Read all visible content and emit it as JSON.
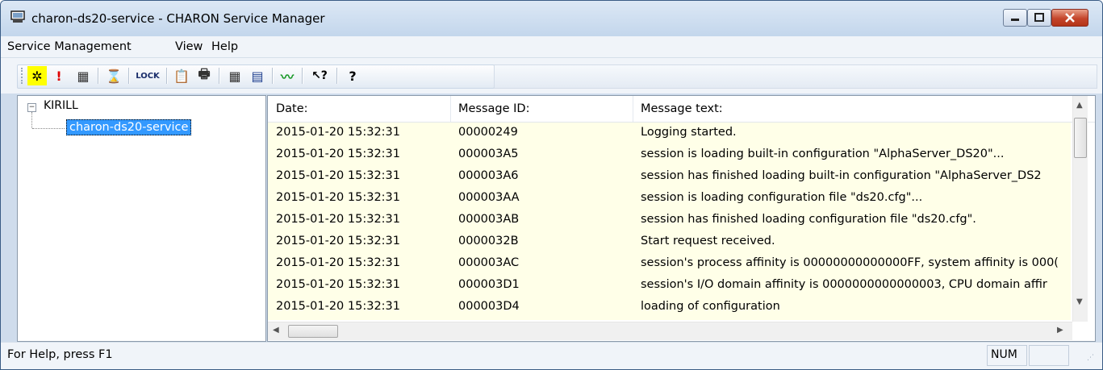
{
  "window": {
    "title": "charon-ds20-service - CHARON Service Manager",
    "controls": {
      "minimize": "minimize",
      "maximize": "maximize",
      "close": "close"
    }
  },
  "menu": [
    {
      "label": "Service Management"
    },
    {
      "label": "View"
    },
    {
      "label": "Help"
    }
  ],
  "toolbar": {
    "buttons": [
      {
        "icon": "service-config-icon",
        "label": "✲"
      },
      {
        "icon": "alert-icon",
        "label": "!"
      },
      {
        "icon": "list-grid-icon",
        "label": "▦"
      },
      {
        "icon": "hourglass-icon",
        "label": "⌛"
      },
      {
        "icon": "lock-icon",
        "label": "LOCK"
      },
      {
        "icon": "clipboard-icon",
        "label": "📋"
      },
      {
        "icon": "print-icon",
        "label": "🖶"
      },
      {
        "icon": "details-view-icon",
        "label": "▦"
      },
      {
        "icon": "list-view-icon",
        "label": "▤"
      },
      {
        "icon": "graph-icon",
        "label": "〰"
      },
      {
        "icon": "context-help-icon",
        "label": "↖?"
      },
      {
        "icon": "help-icon",
        "label": "?"
      }
    ]
  },
  "tree": {
    "root": {
      "label": "KIRILL",
      "expanded": true
    },
    "child": {
      "label": "charon-ds20-service",
      "selected": true
    }
  },
  "log": {
    "columns": [
      "Date:",
      "Message ID:",
      "Message text:"
    ],
    "rows": [
      {
        "date": "2015-01-20 15:32:31",
        "id": "00000249",
        "text": "Logging started."
      },
      {
        "date": "2015-01-20 15:32:31",
        "id": "000003A5",
        "text": "session is loading built-in configuration \"AlphaServer_DS20\"..."
      },
      {
        "date": "2015-01-20 15:32:31",
        "id": "000003A6",
        "text": "session has finished loading built-in configuration \"AlphaServer_DS2"
      },
      {
        "date": "2015-01-20 15:32:31",
        "id": "000003AA",
        "text": "session is loading configuration file \"ds20.cfg\"..."
      },
      {
        "date": "2015-01-20 15:32:31",
        "id": "000003AB",
        "text": "session has finished loading configuration file \"ds20.cfg\"."
      },
      {
        "date": "2015-01-20 15:32:31",
        "id": "0000032B",
        "text": "Start request received."
      },
      {
        "date": "2015-01-20 15:32:31",
        "id": "000003AC",
        "text": "session's process affinity is 00000000000000FF, system affinity is 000("
      },
      {
        "date": "2015-01-20 15:32:31",
        "id": "000003D1",
        "text": "session's I/O domain affinity is 0000000000000003, CPU domain affir"
      },
      {
        "date": "2015-01-20 15:32:31",
        "id": "000003D4",
        "text": "loading of configuration"
      }
    ],
    "row_background": "#ffffe8",
    "selection_color": "#3399ff"
  },
  "status": {
    "help_text": "For Help, press F1",
    "num": "NUM"
  }
}
